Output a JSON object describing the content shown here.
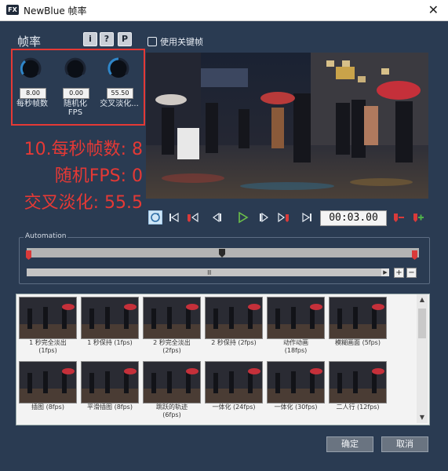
{
  "window": {
    "title": "NewBlue 帧率",
    "app_icon": "FX"
  },
  "section": {
    "title": "帧率"
  },
  "header_buttons": {
    "info": "i",
    "help": "?",
    "presets": "P"
  },
  "keyframe": {
    "label": "使用关键帧",
    "checked": false
  },
  "knobs": [
    {
      "value": "8.00",
      "label": "每秒帧数"
    },
    {
      "value": "0.00",
      "label1": "随机化",
      "label2": "FPS"
    },
    {
      "value": "55.50",
      "label": "交叉淡化..."
    }
  ],
  "overlay": {
    "line1": "10.每秒帧数: 8",
    "line2": "随机FPS: 0",
    "line3": "交叉淡化: 55.5"
  },
  "transport": {
    "time": "00:03.00"
  },
  "automation": {
    "label": "Automation"
  },
  "presets": [
    {
      "name": "1 秒完全淡出",
      "sub": "(1fps)"
    },
    {
      "name": "1 秒保持 (1fps)",
      "sub": ""
    },
    {
      "name": "2 秒完全淡出",
      "sub": "(2fps)"
    },
    {
      "name": "2 秒保持 (2fps)",
      "sub": ""
    },
    {
      "name": "动作动画",
      "sub": "(18fps)"
    },
    {
      "name": "模糊画面 (5fps)",
      "sub": ""
    },
    {
      "name": "插图 (8fps)",
      "sub": ""
    },
    {
      "name": "平滑插图 (8fps)",
      "sub": ""
    },
    {
      "name": "跳跃的轨迹",
      "sub": "(6fps)"
    },
    {
      "name": "一体化 (24fps)",
      "sub": ""
    },
    {
      "name": "一体化 (30fps)",
      "sub": ""
    },
    {
      "name": "二人行 (12fps)",
      "sub": ""
    }
  ],
  "buttons": {
    "ok": "确定",
    "cancel": "取消"
  },
  "colors": {
    "accent": "#e53935",
    "knob_arc": "#2f86c9",
    "window_bg": "#2a3b52"
  }
}
